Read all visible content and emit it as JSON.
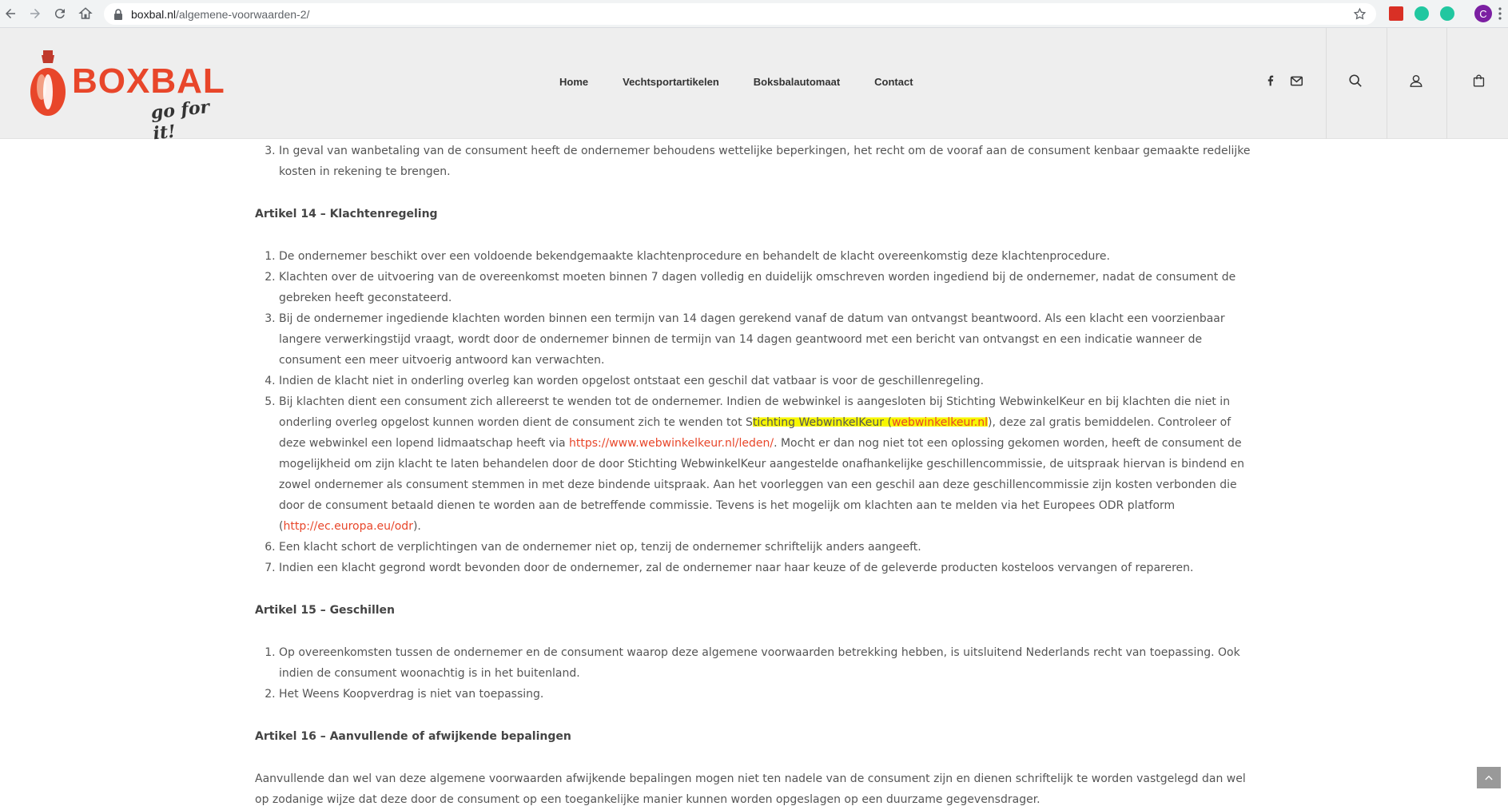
{
  "browser": {
    "url_host": "boxbal.nl",
    "url_path": "/algemene-voorwaarden-2/",
    "profile_initial": "C"
  },
  "header": {
    "logo_word": "BOXBAL",
    "logo_tagline": "go for it!",
    "nav": [
      "Home",
      "Vechtsportartikelen",
      "Boksbalautomaat",
      "Contact"
    ],
    "icons": [
      "facebook-icon",
      "mail-icon",
      "search-icon",
      "account-icon",
      "cart-icon"
    ]
  },
  "article13": {
    "items": [
      {
        "num": "3.",
        "text": "In geval van wanbetaling van de consument heeft de ondernemer behoudens wettelijke beperkingen, het recht om de vooraf aan de consument kenbaar gemaakte redelijke kosten in rekening te brengen."
      }
    ]
  },
  "article14": {
    "title": "Artikel 14 – Klachtenregeling",
    "item1": "De ondernemer beschikt over een voldoende bekendgemaakte klachtenprocedure en behandelt de klacht overeenkomstig deze klachtenprocedure.",
    "item2": "Klachten over de uitvoering van de overeenkomst moeten binnen 7 dagen volledig en duidelijk omschreven worden ingediend bij de ondernemer, nadat de consument de gebreken heeft geconstateerd.",
    "item3": "Bij de ondernemer ingediende klachten worden binnen een termijn van 14 dagen gerekend vanaf de datum van ontvangst beantwoord. Als een klacht een voorzienbaar langere verwerkingstijd vraagt, wordt door de ondernemer binnen de termijn van 14 dagen geantwoord met een bericht van ontvangst en een indicatie wanneer de consument een meer uitvoerig antwoord kan verwachten.",
    "item4": "Indien de klacht niet in onderling overleg kan worden opgelost ontstaat een geschil dat vatbaar is voor de geschillenregeling.",
    "item5_a": "Bij klachten dient een consument zich allereerst te wenden tot de ondernemer. Indien de webwinkel is aangesloten bij Stichting WebwinkelKeur en bij klachten die niet in onderling overleg opgelost kunnen worden dient de consument zich te wenden tot S",
    "item5_highlight": "tichting WebwinkelKeur (",
    "item5_link1": "webwinkelkeur.nl",
    "item5_b": "), deze zal gratis bemiddelen. Controleer of deze webwinkel een lopend lidmaatschap heeft via ",
    "item5_link2": "https://www.webwinkelkeur.nl/leden/",
    "item5_c": ". Mocht er dan nog niet tot een oplossing gekomen worden, heeft de consument de mogelijkheid om zijn klacht te laten behandelen door de door Stichting WebwinkelKeur aangestelde onafhankelijke geschillencommissie, de uitspraak hiervan is bindend en zowel ondernemer als consument stemmen in met deze bindende uitspraak. Aan het voorleggen van een geschil aan deze geschillencommissie zijn kosten verbonden die door de consument betaald dienen te worden aan de betreffende commissie. Tevens is het mogelijk om klachten aan te melden via het Europees ODR platform (",
    "item5_link3": "http://ec.europa.eu/odr",
    "item5_d": ").",
    "item6": "Een klacht schort de verplichtingen van de ondernemer niet op, tenzij de ondernemer schriftelijk anders aangeeft.",
    "item7": "Indien een klacht gegrond wordt bevonden door de ondernemer, zal de ondernemer naar haar keuze of de geleverde producten kosteloos vervangen of repareren."
  },
  "article15": {
    "title": "Artikel 15 – Geschillen",
    "item1": "Op overeenkomsten tussen de ondernemer en de consument waarop deze algemene voorwaarden betrekking hebben, is uitsluitend Nederlands recht van toepassing. Ook indien de consument woonachtig is in het buitenland.",
    "item2": "Het Weens Koopverdrag is niet van toepassing."
  },
  "article16": {
    "title": "Artikel 16 – Aanvullende of afwijkende bepalingen",
    "text": "Aanvullende dan wel van deze algemene voorwaarden afwijkende bepalingen mogen niet ten nadele van de consument zijn en dienen schriftelijk te worden vastgelegd dan wel op zodanige wijze dat deze door de consument op een toegankelijke manier kunnen worden opgeslagen op een duurzame gegevensdrager."
  },
  "colors": {
    "accent": "#e8462a",
    "highlight": "#f7f700",
    "header_bg": "#eeeeee"
  }
}
